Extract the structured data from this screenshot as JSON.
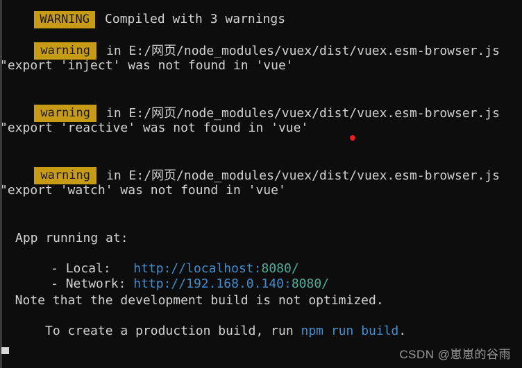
{
  "terminal": {
    "background_color": "#0d0d0d",
    "text_color": "#d2d2d2",
    "badge_color": "#c79b16",
    "warning_text_color": "#b58900",
    "link_color": "#3f8fce",
    "port_color": "#4fae9a",
    "cursor_color": "#d8d8d8",
    "pointer_color": "#e02020"
  },
  "summary": {
    "badge": "WARNING",
    "message": "Compiled with 3 warnings"
  },
  "warnings": [
    {
      "badge": "warning",
      "location": "in E:/网页/node_modules/vuex/dist/vuex.esm-browser.js",
      "detail": "\"export 'inject' was not found in 'vue'"
    },
    {
      "badge": "warning",
      "location": "in E:/网页/node_modules/vuex/dist/vuex.esm-browser.js",
      "detail": "\"export 'reactive' was not found in 'vue'"
    },
    {
      "badge": "warning",
      "location": "in E:/网页/node_modules/vuex/dist/vuex.esm-browser.js",
      "detail": "\"export 'watch' was not found in 'vue'"
    }
  ],
  "app_running": {
    "heading": "App running at:",
    "local_label": "  - Local:   ",
    "local_url_scheme": "http://localhost:",
    "local_url_port": "8080/",
    "network_label": "  - Network: ",
    "network_url_scheme": "http://192.168.0.140:",
    "network_url_port": "8080/"
  },
  "note": {
    "line1": "  Note that the development build is not optimized.",
    "line2_prefix": "  To create a production build, run ",
    "line2_command": "npm run build",
    "line2_suffix": "."
  },
  "watermark": "CSDN @崽崽的谷雨"
}
